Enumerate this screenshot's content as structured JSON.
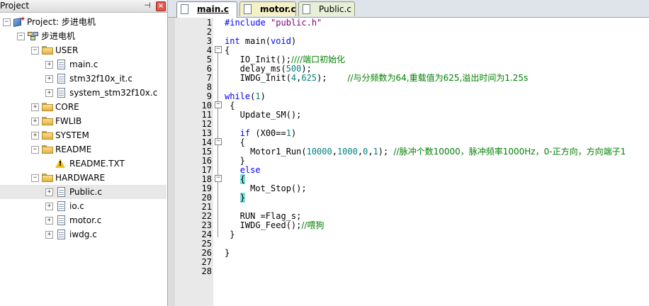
{
  "project_panel": {
    "title": "Project",
    "tree": [
      {
        "label": "Project: 步进电机",
        "icon": "project-icon",
        "level": 0,
        "expander": "−"
      },
      {
        "label": "步进电机",
        "icon": "target-group-icon",
        "level": 1,
        "expander": "−"
      },
      {
        "label": "USER",
        "icon": "folder-icon",
        "level": 2,
        "expander": "−"
      },
      {
        "label": "main.c",
        "icon": "file-icon",
        "level": 3,
        "expander": "+"
      },
      {
        "label": "stm32f10x_it.c",
        "icon": "file-icon",
        "level": 3,
        "expander": "+"
      },
      {
        "label": "system_stm32f10x.c",
        "icon": "file-icon",
        "level": 3,
        "expander": "+"
      },
      {
        "label": "CORE",
        "icon": "folder-icon",
        "level": 2,
        "expander": "+"
      },
      {
        "label": "FWLIB",
        "icon": "folder-icon",
        "level": 2,
        "expander": "+"
      },
      {
        "label": "SYSTEM",
        "icon": "folder-icon",
        "level": 2,
        "expander": "+"
      },
      {
        "label": "README",
        "icon": "folder-icon",
        "level": 2,
        "expander": "−"
      },
      {
        "label": "README.TXT",
        "icon": "warning-icon",
        "level": 3,
        "expander": ""
      },
      {
        "label": "HARDWARE",
        "icon": "folder-icon",
        "level": 2,
        "expander": "−"
      },
      {
        "label": "Public.c",
        "icon": "file-icon",
        "level": 3,
        "expander": "+",
        "selected": true
      },
      {
        "label": "io.c",
        "icon": "file-icon",
        "level": 3,
        "expander": "+"
      },
      {
        "label": "motor.c",
        "icon": "file-icon",
        "level": 3,
        "expander": "+"
      },
      {
        "label": "iwdg.c",
        "icon": "file-icon",
        "level": 3,
        "expander": "+"
      }
    ]
  },
  "editor": {
    "tabs": [
      {
        "label": "main.c",
        "active": true
      },
      {
        "label": "motor.c",
        "active": false
      },
      {
        "label": "Public.c",
        "active": false
      }
    ],
    "line_numbers": [
      "1",
      "2",
      "3",
      "4",
      "5",
      "6",
      "7",
      "8",
      "9",
      "10",
      "11",
      "12",
      "13",
      "14",
      "15",
      "16",
      "17",
      "18",
      "19",
      "20",
      "21",
      "22",
      "23",
      "24",
      "25",
      "26",
      "27",
      "28"
    ],
    "code_lines": [
      [
        {
          "t": "#include ",
          "c": "pp"
        },
        {
          "t": "\"public.h\"",
          "c": "str"
        }
      ],
      [],
      [
        {
          "t": "int",
          "c": "kw"
        },
        {
          "t": " main("
        },
        {
          "t": "void",
          "c": "kw"
        },
        {
          "t": ")"
        }
      ],
      [
        {
          "t": "{"
        }
      ],
      [
        {
          "t": "   IO_Init();"
        },
        {
          "t": "////端口初始化",
          "c": "cm"
        }
      ],
      [
        {
          "t": "   delay_ms("
        },
        {
          "t": "500",
          "c": "num"
        },
        {
          "t": ");"
        }
      ],
      [
        {
          "t": "   IWDG_Init("
        },
        {
          "t": "4",
          "c": "num"
        },
        {
          "t": ","
        },
        {
          "t": "625",
          "c": "num"
        },
        {
          "t": ");    "
        },
        {
          "t": "//与分频数为64,重载值为625,溢出时间为1.25s",
          "c": "cm"
        }
      ],
      [],
      [
        {
          "t": "while",
          "c": "kw"
        },
        {
          "t": "("
        },
        {
          "t": "1",
          "c": "num"
        },
        {
          "t": ")"
        }
      ],
      [
        {
          "t": " {"
        }
      ],
      [
        {
          "t": "   Update_SM();"
        }
      ],
      [],
      [
        {
          "t": "   "
        },
        {
          "t": "if",
          "c": "kw"
        },
        {
          "t": " (X00=="
        },
        {
          "t": "1",
          "c": "num"
        },
        {
          "t": ")"
        }
      ],
      [
        {
          "t": "   {"
        }
      ],
      [
        {
          "t": "     Motor1_Run("
        },
        {
          "t": "10000",
          "c": "num"
        },
        {
          "t": ","
        },
        {
          "t": "1000",
          "c": "num"
        },
        {
          "t": ","
        },
        {
          "t": "0",
          "c": "num"
        },
        {
          "t": ","
        },
        {
          "t": "1",
          "c": "num"
        },
        {
          "t": "); "
        },
        {
          "t": "//脉冲个数10000，脉冲频率1000Hz，0-正方向，方向端子1",
          "c": "cm"
        }
      ],
      [
        {
          "t": "   }"
        }
      ],
      [
        {
          "t": "   "
        },
        {
          "t": "else",
          "c": "kw"
        }
      ],
      [
        {
          "t": "   "
        },
        {
          "t": "{",
          "c": "hl"
        }
      ],
      [
        {
          "t": "     Mot_Stop();"
        }
      ],
      [
        {
          "t": "   "
        },
        {
          "t": "}",
          "c": "hl"
        }
      ],
      [],
      [
        {
          "t": "   RUN =Flag_s;"
        }
      ],
      [
        {
          "t": "   IWDG_Feed();"
        },
        {
          "t": "//喂狗",
          "c": "cm"
        }
      ],
      [
        {
          "t": " }"
        }
      ],
      [],
      [
        {
          "t": "}"
        }
      ],
      [],
      []
    ]
  }
}
